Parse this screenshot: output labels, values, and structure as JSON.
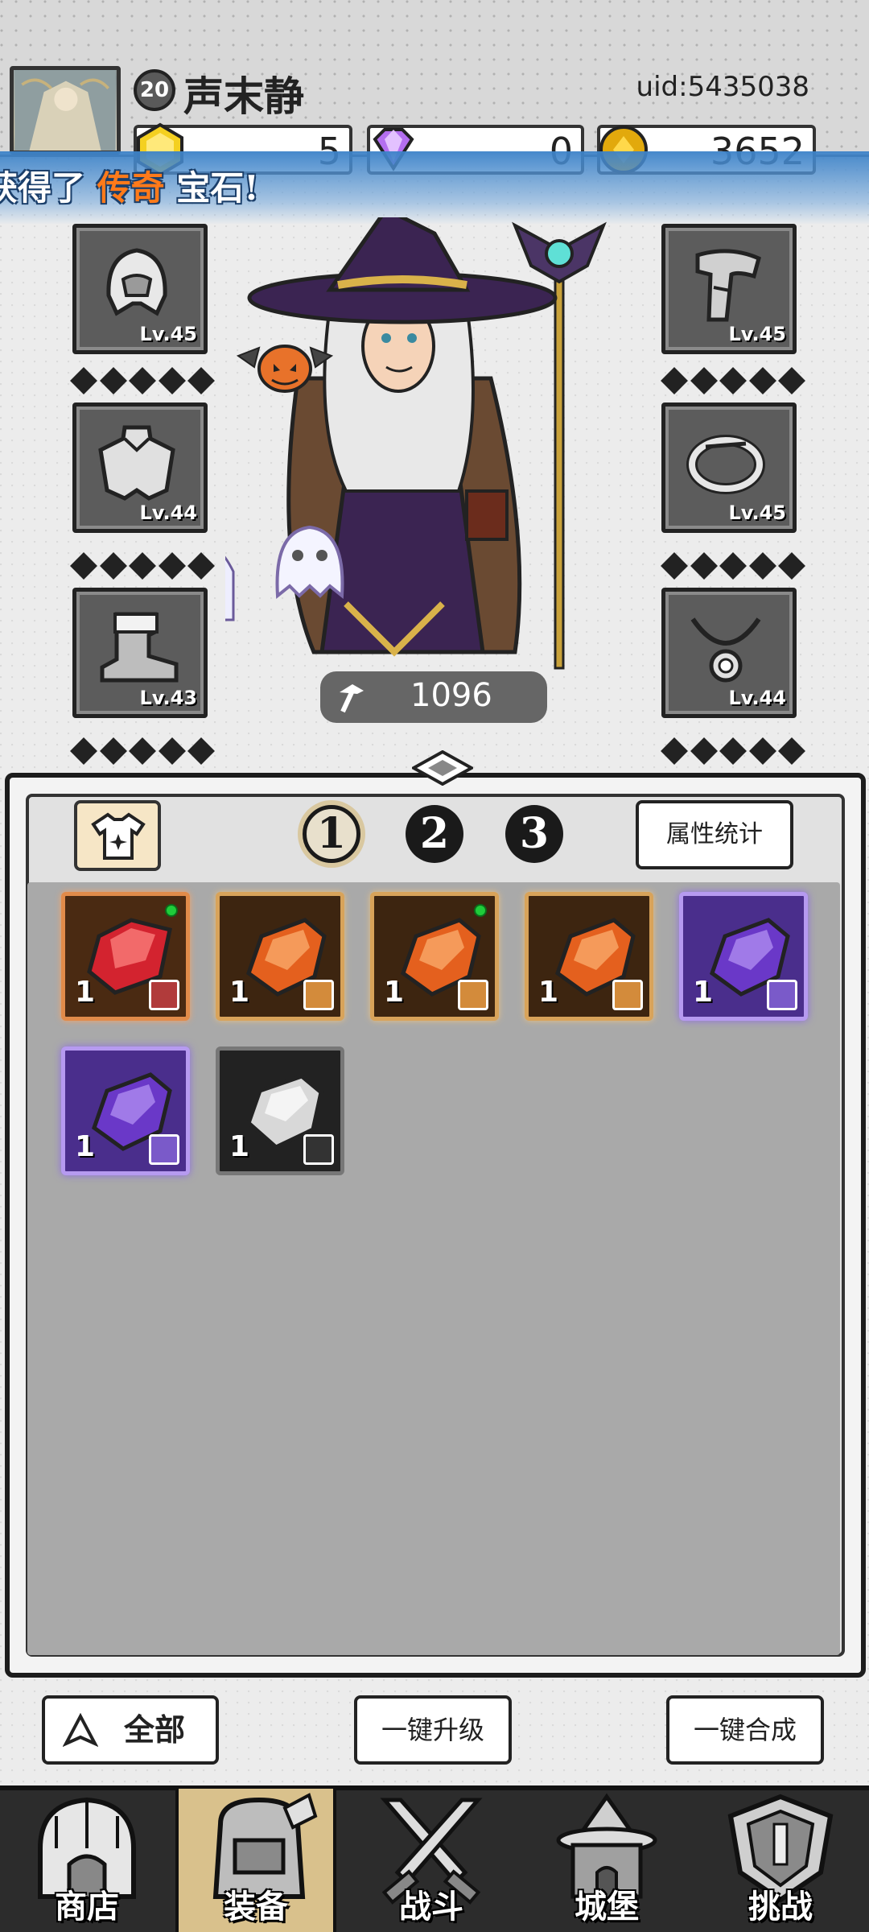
{
  "header": {
    "level": "20",
    "player_name": "声末静",
    "uid": "uid:5435038",
    "currencies": [
      {
        "icon": "yellow-gem-icon",
        "amount": "5"
      },
      {
        "icon": "purple-diamond-icon",
        "amount": "0"
      },
      {
        "icon": "gold-coin-icon",
        "amount": "3652"
      }
    ]
  },
  "banner": {
    "prefix": "获得了",
    "highlight": "传奇",
    "suffix": "宝石!",
    "highlight_color": "#ff7a1a"
  },
  "equipment": {
    "left": [
      {
        "icon": "helmet-icon",
        "level": "Lv.45"
      },
      {
        "icon": "cloak-icon",
        "level": "Lv.44"
      },
      {
        "icon": "boot-icon",
        "level": "Lv.43"
      }
    ],
    "right": [
      {
        "icon": "bracer-icon",
        "level": "Lv.45"
      },
      {
        "icon": "ring-icon",
        "level": "Lv.45"
      },
      {
        "icon": "necklace-icon",
        "level": "Lv.44"
      }
    ],
    "power": "1096"
  },
  "inventory": {
    "pages": [
      "1",
      "2",
      "3"
    ],
    "active_page": "1",
    "stats_label": "属性统计",
    "gems": [
      {
        "color": "red",
        "qty": "1",
        "slot": "bracer",
        "new": true
      },
      {
        "color": "orange",
        "qty": "1",
        "slot": "boot",
        "new": false
      },
      {
        "color": "orange",
        "qty": "1",
        "slot": "weapon",
        "new": true
      },
      {
        "color": "orange",
        "qty": "1",
        "slot": "helmet",
        "new": false
      },
      {
        "color": "purple",
        "qty": "1",
        "slot": "cloak",
        "new": false
      },
      {
        "color": "purple",
        "qty": "1",
        "slot": "helmet",
        "new": false
      },
      {
        "color": "grey",
        "qty": "1",
        "slot": "necklace",
        "new": false
      }
    ]
  },
  "actions": {
    "all": "全部",
    "upgrade_all": "一键升级",
    "merge_all": "一键合成"
  },
  "nav": [
    {
      "label": "商店",
      "icon": "shop-icon",
      "active": false
    },
    {
      "label": "装备",
      "icon": "backpack-icon",
      "active": true
    },
    {
      "label": "战斗",
      "icon": "crossed-swords-icon",
      "active": false
    },
    {
      "label": "城堡",
      "icon": "castle-icon",
      "active": false
    },
    {
      "label": "挑战",
      "icon": "challenge-shield-icon",
      "active": false
    }
  ]
}
